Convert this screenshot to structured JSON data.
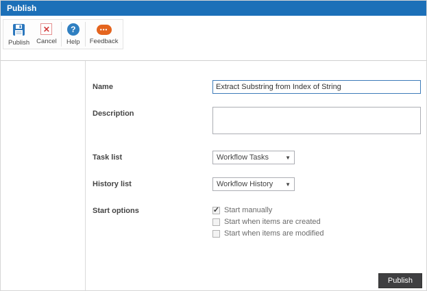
{
  "header": {
    "title": "Publish"
  },
  "toolbar": {
    "items": [
      {
        "label": "Publish"
      },
      {
        "label": "Cancel"
      },
      {
        "label": "Help"
      },
      {
        "label": "Feedback"
      }
    ]
  },
  "icons": {
    "cancel_glyph": "✕",
    "help_glyph": "?",
    "feedback_glyph": "•••",
    "dropdown_arrow": "▼",
    "check_mark": "✓"
  },
  "form": {
    "name": {
      "label": "Name",
      "value": "Extract Substring from Index of String"
    },
    "description": {
      "label": "Description",
      "value": ""
    },
    "task_list": {
      "label": "Task list",
      "selected": "Workflow Tasks"
    },
    "history_list": {
      "label": "History list",
      "selected": "Workflow History"
    },
    "start_options": {
      "label": "Start options",
      "options": [
        {
          "label": "Start manually",
          "checked": true,
          "mark": "✓"
        },
        {
          "label": "Start when items are created",
          "checked": false,
          "mark": ""
        },
        {
          "label": "Start when items are modified",
          "checked": false,
          "mark": ""
        }
      ]
    }
  },
  "footer": {
    "publish_label": "Publish"
  },
  "colors": {
    "header_bg": "#1c70b8",
    "accent_blue": "#2f7fc1",
    "cancel_red": "#d03a3a",
    "feedback_orange": "#e4641e",
    "publish_button_bg": "#3f3f41"
  }
}
